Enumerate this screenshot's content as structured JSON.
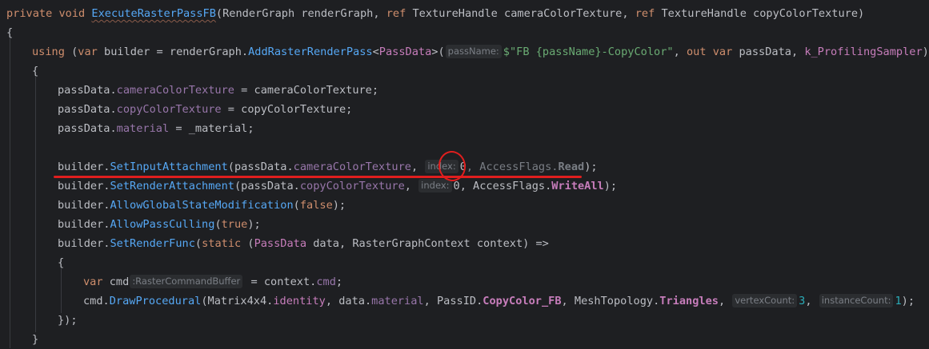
{
  "code": {
    "line_sig": {
      "kw_private": "private",
      "kw_void": "void",
      "method_name": "ExecuteRasterPassFB",
      "param_list": "(RenderGraph renderGraph, ",
      "kw_ref1": "ref",
      "type1": " TextureHandle cameraColorTexture, ",
      "kw_ref2": "ref",
      "type2": " TextureHandle copyColorTexture)"
    },
    "line_open": "{",
    "line_using": {
      "kw_using": "using",
      "p1": " (",
      "kw_var": "var",
      "p2": " builder = renderGraph.",
      "fn": "AddRasterRenderPass",
      "p3": "<",
      "type": "PassData",
      "p4": ">(",
      "hint": "passName:",
      "str": "$\"FB {passName}-CopyColor\"",
      "p5": ", ",
      "kw_out": "out",
      "p6": " ",
      "kw_var2": "var",
      "p7": " passData, ",
      "sampler": "k_ProfilingSampler",
      "p8": "))"
    },
    "line_open2": "{",
    "line_a1": {
      "obj": "passData.",
      "prop": "cameraColorTexture",
      "rest": " = cameraColorTexture;"
    },
    "line_a2": {
      "obj": "passData.",
      "prop": "copyColorTexture",
      "rest": " = copyColorTexture;"
    },
    "line_a3": {
      "obj": "passData.",
      "prop": "material",
      "rest": " = _material;"
    },
    "line_b1": {
      "obj": "builder.",
      "fn": "SetInputAttachment",
      "p1": "(passData.",
      "prop": "cameraColorTexture",
      "p2": ", ",
      "hint": "index:",
      "num": "0",
      "p3": ", ",
      "enum_type": "AccessFlags.",
      "enum_val": "Read",
      "p4": ");"
    },
    "line_b2": {
      "obj": "builder.",
      "fn": "SetRenderAttachment",
      "p1": "(passData.",
      "prop": "copyColorTexture",
      "p2": ", ",
      "hint": "index:",
      "num": "0",
      "p3": ", AccessFlags.",
      "enum_val": "WriteAll",
      "p4": ");"
    },
    "line_b3": {
      "obj": "builder.",
      "fn": "AllowGlobalStateModification",
      "p1": "(",
      "kw": "false",
      "p2": ");"
    },
    "line_b4": {
      "obj": "builder.",
      "fn": "AllowPassCulling",
      "p1": "(",
      "kw": "true",
      "p2": ");"
    },
    "line_b5": {
      "obj": "builder.",
      "fn": "SetRenderFunc",
      "p1": "(",
      "kw_static": "static",
      "p2": " (",
      "type1": "PassData",
      "p3": " data, RasterGraphContext context) =>"
    },
    "line_open3": "{",
    "line_c1": {
      "kw_var": "var",
      "p1": " cmd",
      "hint": ":RasterCommandBuffer",
      "p2": " = context.",
      "prop": "cmd",
      "p3": ";"
    },
    "line_c2": {
      "obj": "cmd.",
      "fn": "DrawProcedural",
      "p1": "(Matrix4x4.",
      "static_member": "identity",
      "p2": ", data.",
      "prop": "material",
      "p3": ", PassID.",
      "enum1": "CopyColor_FB",
      "p4": ", MeshTopology.",
      "enum2": "Triangles",
      "p5": ", ",
      "hint1": "vertexCount:",
      "num1": "3",
      "p6": ", ",
      "hint2": "instanceCount:",
      "num2": "1",
      "p7": ");"
    },
    "line_close3": "});",
    "line_close2": "}"
  },
  "colors": {
    "background": "#1e1f22",
    "keyword": "#cf8e6d",
    "function": "#56a8f5",
    "property": "#9876aa",
    "type": "#c77dbb",
    "string": "#6aab73",
    "number": "#2aacb8",
    "annotation_red": "#e01e1e"
  }
}
